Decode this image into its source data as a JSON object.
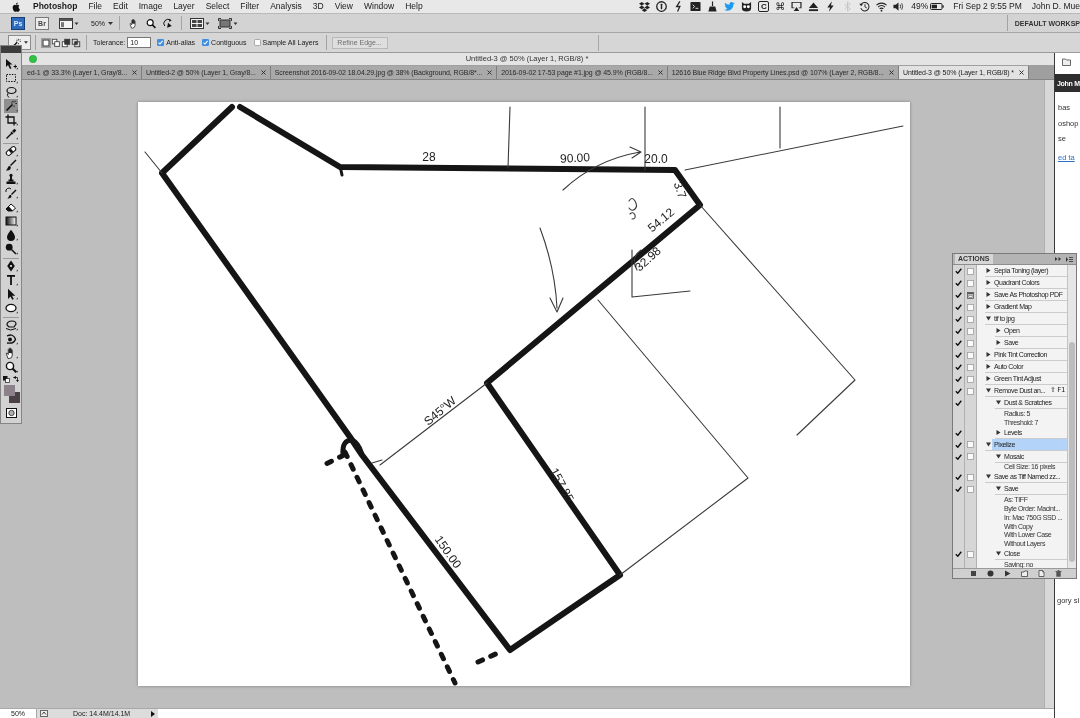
{
  "menu_bar": {
    "app_name": "Photoshop",
    "menus": [
      "File",
      "Edit",
      "Image",
      "Layer",
      "Select",
      "Filter",
      "Analysis",
      "3D",
      "View",
      "Window",
      "Help"
    ],
    "extra_letter": "C",
    "extra_symbol": "⌘",
    "battery_text": "49%",
    "clock": "Fri Sep 2 9:55 PM",
    "user": "John D. Mue"
  },
  "app_bar": {
    "ps_logo": "Ps",
    "br_logo": "Br",
    "zoom": "50%",
    "workspace": "DEFAULT WORKSP"
  },
  "options_bar": {
    "selection_modes": [
      {
        "selected": true
      },
      {
        "selected": false
      },
      {
        "selected": false
      },
      {
        "selected": false
      }
    ],
    "tolerance_label": "Tolerance:",
    "tolerance": "10",
    "checkboxes": [
      {
        "label": "Anti-alias",
        "checked": true
      },
      {
        "label": "Contiguous",
        "checked": true
      },
      {
        "label": "Sample All Layers",
        "checked": false
      }
    ],
    "refine_edge": {
      "label": "Refine Edge...",
      "disabled": true
    }
  },
  "tools": [
    {
      "kind": "move",
      "selected": false
    },
    {
      "kind": "marquee",
      "selected": false
    },
    {
      "kind": "lasso",
      "selected": false
    },
    {
      "kind": "wand",
      "selected": true
    },
    {
      "kind": "crop",
      "selected": false
    },
    {
      "kind": "eyedropper",
      "selected": false
    },
    {
      "kind": "healing",
      "selected": false
    },
    {
      "kind": "brush",
      "selected": false
    },
    {
      "kind": "stamp",
      "selected": false
    },
    {
      "kind": "historybrush",
      "selected": false
    },
    {
      "kind": "eraser",
      "selected": false
    },
    {
      "kind": "gradient",
      "selected": false
    },
    {
      "kind": "blur",
      "selected": false
    },
    {
      "kind": "dodge",
      "selected": false
    },
    {
      "kind": "pen",
      "selected": false
    },
    {
      "kind": "type",
      "selected": false
    },
    {
      "kind": "pathselect",
      "selected": false
    },
    {
      "kind": "shape",
      "selected": false
    },
    {
      "kind": "rotate3d",
      "selected": false
    },
    {
      "kind": "orbit3d",
      "selected": false
    },
    {
      "kind": "hand",
      "selected": false
    },
    {
      "kind": "zoom",
      "selected": false
    }
  ],
  "color_swatches": [
    {
      "color": "#8b8289"
    },
    {
      "color": "#4a4147"
    }
  ],
  "document_window": {
    "title": "Untitled-3 @ 50% (Layer 1, RGB/8) *",
    "tabs": [
      {
        "label": "ed-1 @ 33.3% (Layer 1, Gray/8...",
        "selected": false
      },
      {
        "label": "Untitled-2 @ 50% (Layer 1, Gray/8...",
        "selected": false
      },
      {
        "label": "Screenshot 2016-09-02 18.04.29.jpg @ 38% (Background, RGB/8*...",
        "selected": false
      },
      {
        "label": "2016-09-02 17-53 page #1.jpg @ 45.9% (RGB/8...",
        "selected": false
      },
      {
        "label": "12616 Blue Ridge Blvd Property Lines.psd @ 107% (Layer 2, RGB/8...",
        "selected": false
      },
      {
        "label": "Untitled-3 @ 50% (Layer 1, RGB/8) *",
        "selected": true
      }
    ],
    "canvas": {
      "labels": [
        "28",
        "90.00",
        "20.0",
        "3.7",
        "54.12",
        "32.98",
        "S45°W",
        "157.85",
        "150.00"
      ]
    },
    "status_bar": {
      "zoom": "50%",
      "doc_size": "Doc: 14.4M/14.1M"
    }
  },
  "actions_panel": {
    "title": "ACTIONS",
    "items": [
      {
        "label": "Sepia Toning (layer)",
        "checked": true,
        "dialog": true,
        "dialog_on": false,
        "expanded": false,
        "selected": false
      },
      {
        "label": "Quadrant Colors",
        "checked": true,
        "dialog": true,
        "dialog_on": false,
        "expanded": false,
        "selected": false
      },
      {
        "label": "Save As Photoshop PDF",
        "checked": true,
        "dialog": true,
        "dialog_on": true,
        "expanded": false,
        "selected": false
      },
      {
        "label": "Gradient Map",
        "checked": true,
        "dialog": true,
        "dialog_on": false,
        "expanded": false,
        "selected": false
      },
      {
        "label": "tif to jpg",
        "checked": true,
        "dialog": true,
        "dialog_on": false,
        "expanded": true,
        "selected": false,
        "children": [
          {
            "label": "Open",
            "checked": true,
            "dialog": true,
            "dialog_on": false,
            "expanded": false,
            "selected": false
          },
          {
            "label": "Save",
            "checked": true,
            "dialog": true,
            "dialog_on": false,
            "expanded": false,
            "selected": false
          }
        ]
      },
      {
        "label": "Pink Tint Correction",
        "checked": true,
        "dialog": true,
        "dialog_on": false,
        "expanded": false,
        "selected": false
      },
      {
        "label": "Auto Color",
        "checked": true,
        "dialog": true,
        "dialog_on": false,
        "expanded": false,
        "selected": false
      },
      {
        "label": "Green Tint Adjust",
        "checked": true,
        "dialog": true,
        "dialog_on": false,
        "expanded": false,
        "selected": false
      },
      {
        "label": "Remove Dust an...",
        "shortcut": "⇧ F1",
        "checked": true,
        "dialog": true,
        "dialog_on": false,
        "expanded": true,
        "selected": false,
        "children": [
          {
            "label": "Dust & Scratches",
            "checked": true,
            "dialog": false,
            "dialog_on": false,
            "expanded": true,
            "selected": false,
            "details": [
              "Radius: 5",
              "Threshold: 7"
            ]
          },
          {
            "label": "Levels",
            "checked": true,
            "dialog": false,
            "dialog_on": false,
            "expanded": false,
            "selected": false
          }
        ]
      },
      {
        "label": "Pixelize",
        "checked": true,
        "dialog": true,
        "dialog_on": false,
        "expanded": true,
        "selected": true,
        "children": [
          {
            "label": "Mosaic",
            "checked": true,
            "dialog": true,
            "dialog_on": false,
            "expanded": true,
            "selected": false,
            "details": [
              "Cell Size: 16 pixels"
            ]
          }
        ]
      },
      {
        "label": "Save as Tiff Named zz...",
        "checked": true,
        "dialog": true,
        "dialog_on": false,
        "expanded": true,
        "selected": false,
        "children": [
          {
            "label": "Save",
            "checked": true,
            "dialog": true,
            "dialog_on": false,
            "expanded": true,
            "selected": false,
            "details": [
              "As: TIFF",
              "Byte Order: Macint...",
              "In: Mac 750G SSD ...",
              "With Copy",
              "With Lower Case",
              "Without Layers"
            ]
          },
          {
            "label": "Close",
            "checked": true,
            "dialog": true,
            "dialog_on": false,
            "expanded": true,
            "selected": false,
            "details": [
              "Saving: no"
            ]
          }
        ]
      }
    ]
  },
  "browser_window": {
    "header": "John M",
    "lines": [
      {
        "kind": "text",
        "text": "bas"
      },
      {
        "kind": "text",
        "text": "oshop"
      },
      {
        "kind": "text",
        "text": "se"
      },
      {
        "kind": "link",
        "text": "ed ta"
      }
    ],
    "footer_text": "gory sl"
  }
}
